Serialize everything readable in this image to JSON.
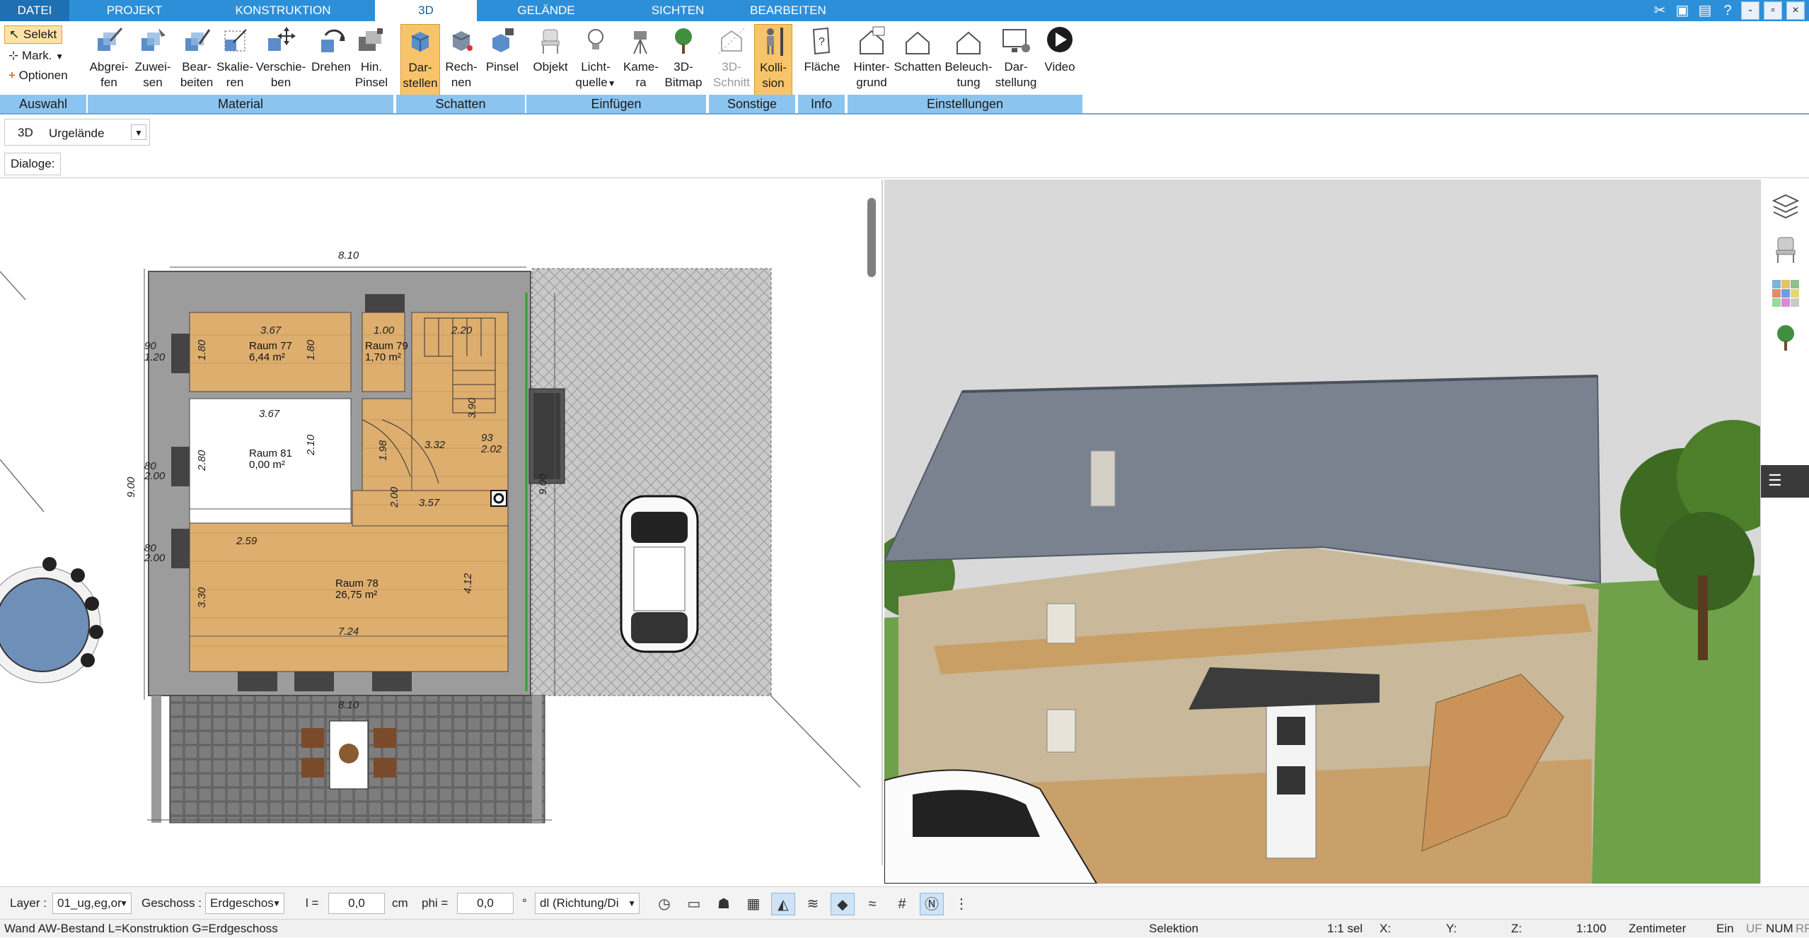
{
  "menu": {
    "tabs": [
      "DATEI",
      "PROJEKT",
      "KONSTRUKTION",
      "3D",
      "GELÄNDE",
      "SICHTEN",
      "BEARBEITEN"
    ],
    "active": "3D"
  },
  "ribbon": {
    "auswahl": {
      "selekt": "Selekt",
      "mark": "Mark.",
      "optionen": "Optionen",
      "group": "Auswahl"
    },
    "material": {
      "group": "Material",
      "buttons": [
        {
          "l1": "Abgrei-",
          "l2": "fen"
        },
        {
          "l1": "Zuwei-",
          "l2": "sen"
        },
        {
          "l1": "Bear-",
          "l2": "beiten"
        },
        {
          "l1": "Skalie-",
          "l2": "ren"
        },
        {
          "l1": "Verschie-",
          "l2": "ben"
        },
        {
          "l1": "Drehen",
          "l2": ""
        },
        {
          "l1": "Hin.",
          "l2": "Pinsel"
        }
      ]
    },
    "schatten": {
      "group": "Schatten",
      "buttons": [
        {
          "l1": "Dar-",
          "l2": "stellen"
        },
        {
          "l1": "Rech-",
          "l2": "nen"
        },
        {
          "l1": "Pinsel",
          "l2": ""
        }
      ]
    },
    "einfuegen": {
      "group": "Einfügen",
      "buttons": [
        {
          "l1": "Objekt",
          "l2": ""
        },
        {
          "l1": "Licht-",
          "l2": "quelle"
        },
        {
          "l1": "Kame-",
          "l2": "ra"
        },
        {
          "l1": "3D-",
          "l2": "Bitmap"
        }
      ]
    },
    "sonstige": {
      "group": "Sonstige",
      "buttons": [
        {
          "l1": "3D-",
          "l2": "Schnitt"
        },
        {
          "l1": "Kolli-",
          "l2": "sion"
        }
      ]
    },
    "info": {
      "group": "Info",
      "buttons": [
        {
          "l1": "Fläche",
          "l2": ""
        }
      ]
    },
    "einstellungen": {
      "group": "Einstellungen",
      "buttons": [
        {
          "l1": "Hinter-",
          "l2": "grund"
        },
        {
          "l1": "Schatten",
          "l2": ""
        },
        {
          "l1": "Beleuch-",
          "l2": "tung"
        },
        {
          "l1": "Dar-",
          "l2": "stellung"
        },
        {
          "l1": "Video",
          "l2": ""
        }
      ]
    }
  },
  "layerrow": {
    "mode": "3D",
    "value": "Urgelände"
  },
  "dialogrow": {
    "label": "Dialoge:"
  },
  "plan": {
    "dims": {
      "top": "8.10",
      "left": "9.00",
      "right": "9.00",
      "bottom": "8.10",
      "d367a": "3.67",
      "d100": "1.00",
      "d220": "2.20",
      "d367b": "3.67",
      "d280": "2.80",
      "d210": "2.10",
      "d357": "3.57",
      "d259": "2.59",
      "d330": "3.30",
      "d412": "4.12",
      "d724": "7.24",
      "d180a": "1.80",
      "d180b": "1.80",
      "d90": "90",
      "d120": "1.20",
      "d80": "80",
      "d200": "2.00",
      "d93": "93",
      "d202": "2.02",
      "d332": "3.32",
      "d198": "1.98",
      "d390": "3.90",
      "d200b": "2.00",
      "d1120": "1.20"
    },
    "rooms": [
      {
        "name": "Raum 77",
        "area": "6,44 m²"
      },
      {
        "name": "Raum 79",
        "area": "1,70 m²"
      },
      {
        "name": "Raum 81",
        "area": "0,00 m²"
      },
      {
        "name": "Raum 78",
        "area": "26,75 m²"
      }
    ]
  },
  "bottombar": {
    "layer_label": "Layer :",
    "layer_value": "01_ug,eg,or",
    "geschoss_label": "Geschoss :",
    "geschoss_value": "Erdgeschos",
    "l_label": "l =",
    "l_value": "0,0",
    "l_unit": "cm",
    "phi_label": "phi =",
    "phi_value": "0,0",
    "phi_unit": "°",
    "dl_value": "dl (Richtung/Di"
  },
  "status": {
    "left": "Wand AW-Bestand L=Konstruktion G=Erdgeschoss",
    "selektion": "Selektion",
    "sel": "1:1 sel",
    "x": "X:",
    "y": "Y:",
    "z": "Z:",
    "scale": "1:100",
    "unit": "Zentimeter",
    "ein": "Ein",
    "uf": "UF",
    "num": "NUM",
    "rf": "RF"
  },
  "colors": {
    "menubar": "#2e8fd9",
    "groupbar": "#8cc4f0",
    "active_button": "#f7c46b",
    "floor": "#dfae6c",
    "wall": "#9c9c9c"
  },
  "icons": {
    "layers": "layers-icon",
    "chair": "chair-icon",
    "texture": "texture-icon",
    "tree": "tree-icon"
  }
}
